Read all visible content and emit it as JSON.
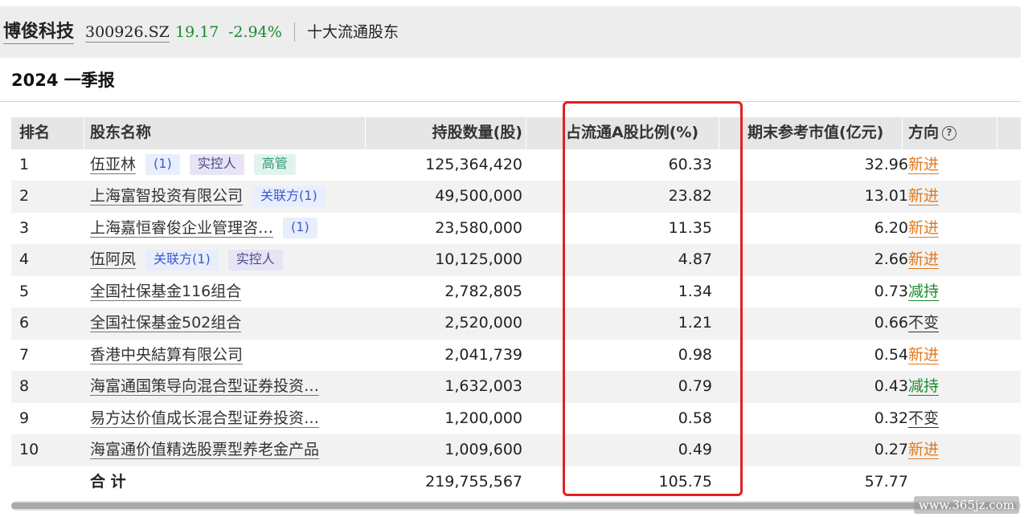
{
  "header": {
    "stock_name": "博俊科技",
    "stock_code": "300926.SZ",
    "price": "19.17",
    "change_pct": "-2.94%",
    "section": "十大流通股东"
  },
  "report": {
    "title": "2024 一季报"
  },
  "table": {
    "columns": {
      "rank": "排名",
      "holder": "股东名称",
      "shares": "持股数量(股)",
      "pct": "占流通A股比例(%)",
      "value": "期末参考市值(亿元)",
      "direction": "方向",
      "help_icon": "?"
    },
    "rows": [
      {
        "rank": "1",
        "holder": "伍亚林",
        "tags": [
          "(1)",
          "实控人",
          "高管"
        ],
        "shares": "125,364,420",
        "pct": "60.33",
        "value": "32.96",
        "direction": "新进"
      },
      {
        "rank": "2",
        "holder": "上海富智投资有限公司",
        "tags": [
          "关联方(1)"
        ],
        "shares": "49,500,000",
        "pct": "23.82",
        "value": "13.01",
        "direction": "新进"
      },
      {
        "rank": "3",
        "holder": "上海嘉恒睿俊企业管理咨…",
        "tags": [
          "(1)"
        ],
        "shares": "23,580,000",
        "pct": "11.35",
        "value": "6.20",
        "direction": "新进"
      },
      {
        "rank": "4",
        "holder": "伍阿凤",
        "tags": [
          "关联方(1)",
          "实控人"
        ],
        "shares": "10,125,000",
        "pct": "4.87",
        "value": "2.66",
        "direction": "新进"
      },
      {
        "rank": "5",
        "holder": "全国社保基金116组合",
        "tags": [],
        "shares": "2,782,805",
        "pct": "1.34",
        "value": "0.73",
        "direction": "减持"
      },
      {
        "rank": "6",
        "holder": "全国社保基金502组合",
        "tags": [],
        "shares": "2,520,000",
        "pct": "1.21",
        "value": "0.66",
        "direction": "不变"
      },
      {
        "rank": "7",
        "holder": "香港中央結算有限公司",
        "tags": [],
        "shares": "2,041,739",
        "pct": "0.98",
        "value": "0.54",
        "direction": "新进"
      },
      {
        "rank": "8",
        "holder": "海富通国策导向混合型证券投资…",
        "tags": [],
        "shares": "1,632,003",
        "pct": "0.79",
        "value": "0.43",
        "direction": "减持"
      },
      {
        "rank": "9",
        "holder": "易方达价值成长混合型证券投资…",
        "tags": [],
        "shares": "1,200,000",
        "pct": "0.58",
        "value": "0.32",
        "direction": "不变"
      },
      {
        "rank": "10",
        "holder": "海富通价值精选股票型养老金产品",
        "tags": [],
        "shares": "1,009,600",
        "pct": "0.49",
        "value": "0.27",
        "direction": "新进"
      }
    ],
    "total": {
      "label": "合 计",
      "shares": "219,755,567",
      "pct": "105.75",
      "value": "57.77"
    }
  },
  "colors": {
    "new": "#e07a1f",
    "decrease": "#1b8a2e",
    "unchanged": "#333333",
    "highlight": "#e02020",
    "price_down": "#1b8a2e"
  },
  "watermark": "www.365jz.com"
}
